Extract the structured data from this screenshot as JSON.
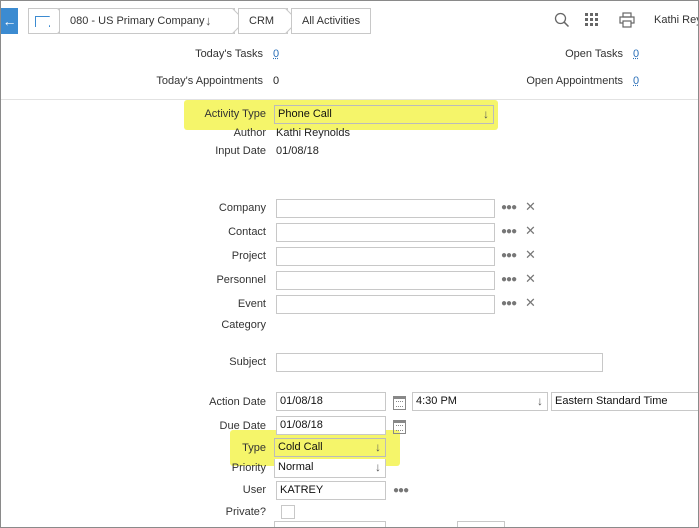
{
  "breadcrumb": {
    "company": "080 - US Primary Company",
    "module": "CRM",
    "page": "All Activities"
  },
  "header": {
    "user": "Kathi Reynolds"
  },
  "summary": {
    "todays_tasks_label": "Today's Tasks",
    "todays_tasks_value": "0",
    "todays_appointments_label": "Today's Appointments",
    "todays_appointments_value": "0",
    "open_tasks_label": "Open Tasks",
    "open_tasks_value": "0",
    "open_appointments_label": "Open Appointments",
    "open_appointments_value": "0"
  },
  "form": {
    "activity_type_label": "Activity Type",
    "activity_type_value": "Phone Call",
    "author_label": "Author",
    "author_value": "Kathi Reynolds",
    "input_date_label": "Input Date",
    "input_date_value": "01/08/18",
    "company_label": "Company",
    "contact_label": "Contact",
    "project_label": "Project",
    "personnel_label": "Personnel",
    "event_label": "Event",
    "category_label": "Category",
    "subject_label": "Subject",
    "action_date_label": "Action Date",
    "action_date_value": "01/08/18",
    "action_time_value": "4:30 PM",
    "timezone_value": "Eastern Standard Time",
    "due_date_label": "Due Date",
    "due_date_value": "01/08/18",
    "type_label": "Type",
    "type_value": "Cold Call",
    "priority_label": "Priority",
    "priority_value": "Normal",
    "user_label": "User",
    "user_value": "KATREY",
    "private_label": "Private?"
  },
  "colors": {
    "accent": "#3c8bd1",
    "highlight": "#f5f56a",
    "link": "#2a6fb8"
  }
}
